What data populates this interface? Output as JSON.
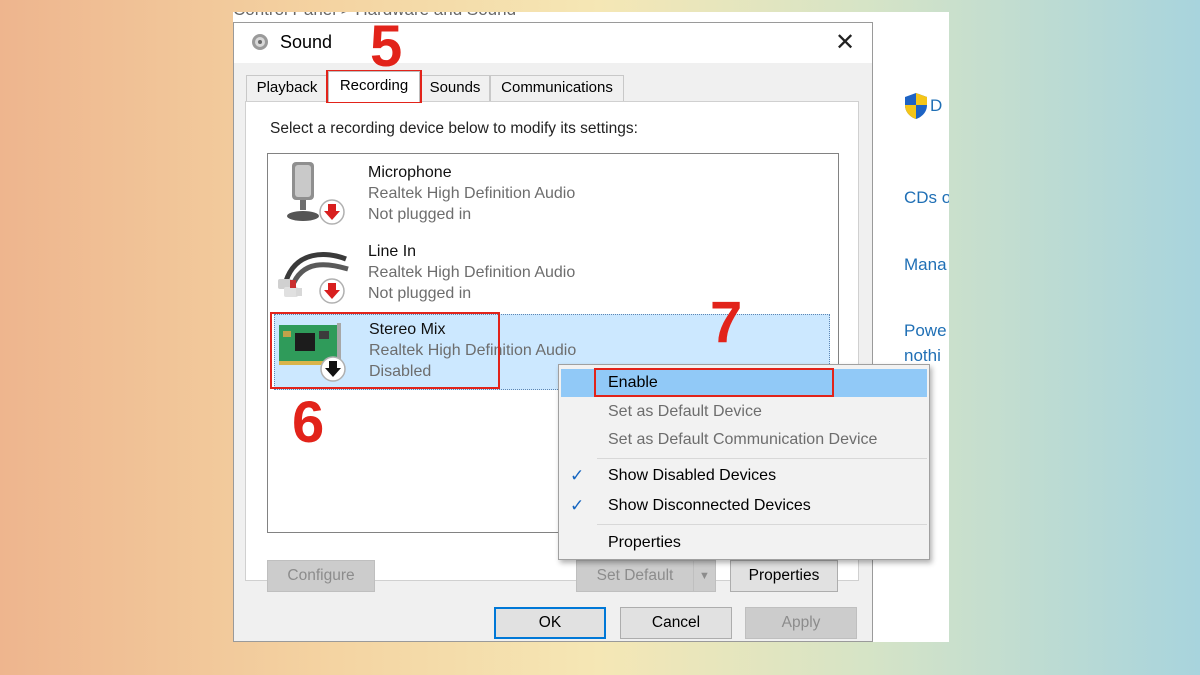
{
  "background": {
    "breadcrumb": "Control Panel  >  Hardware and Sound",
    "right_links": [
      "D",
      "CDs o",
      "Mana",
      "Powe",
      "nothi"
    ]
  },
  "dialog": {
    "title": "Sound",
    "close_glyph": "✕",
    "tabs": [
      {
        "label": "Playback",
        "active": false
      },
      {
        "label": "Recording",
        "active": true
      },
      {
        "label": "Sounds",
        "active": false
      },
      {
        "label": "Communications",
        "active": false
      }
    ],
    "instruction": "Select a recording device below to modify its settings:",
    "devices": [
      {
        "name": "Microphone",
        "driver": "Realtek High Definition Audio",
        "status": "Not plugged in",
        "icon": "microphone-icon",
        "badge": "red-down-arrow",
        "selected": false
      },
      {
        "name": "Line In",
        "driver": "Realtek High Definition Audio",
        "status": "Not plugged in",
        "icon": "line-in-cable-icon",
        "badge": "red-down-arrow",
        "selected": false
      },
      {
        "name": "Stereo Mix",
        "driver": "Realtek High Definition Audio",
        "status": "Disabled",
        "icon": "sound-card-icon",
        "badge": "black-down-arrow",
        "selected": true
      }
    ],
    "buttons": {
      "configure": "Configure",
      "set_default": "Set Default",
      "properties": "Properties",
      "ok": "OK",
      "cancel": "Cancel",
      "apply": "Apply"
    }
  },
  "context_menu": {
    "items": [
      {
        "label": "Enable",
        "highlighted": true,
        "enabled": true,
        "checked": false
      },
      {
        "label": "Set as Default Device",
        "enabled": false,
        "checked": false
      },
      {
        "label": "Set as Default Communication Device",
        "enabled": false,
        "checked": false
      },
      {
        "label": "Show Disabled Devices",
        "enabled": true,
        "checked": true
      },
      {
        "label": "Show Disconnected Devices",
        "enabled": true,
        "checked": true
      },
      {
        "label": "Properties",
        "enabled": true,
        "checked": false
      }
    ],
    "check_glyph": "✓"
  },
  "annotations": {
    "steps": [
      "5",
      "6",
      "7"
    ],
    "color": "#e2231a"
  },
  "colors": {
    "selection": "#cce8ff",
    "menu_highlight": "#91c9f7",
    "link": "#1f6fb5",
    "accent": "#0078d7"
  }
}
